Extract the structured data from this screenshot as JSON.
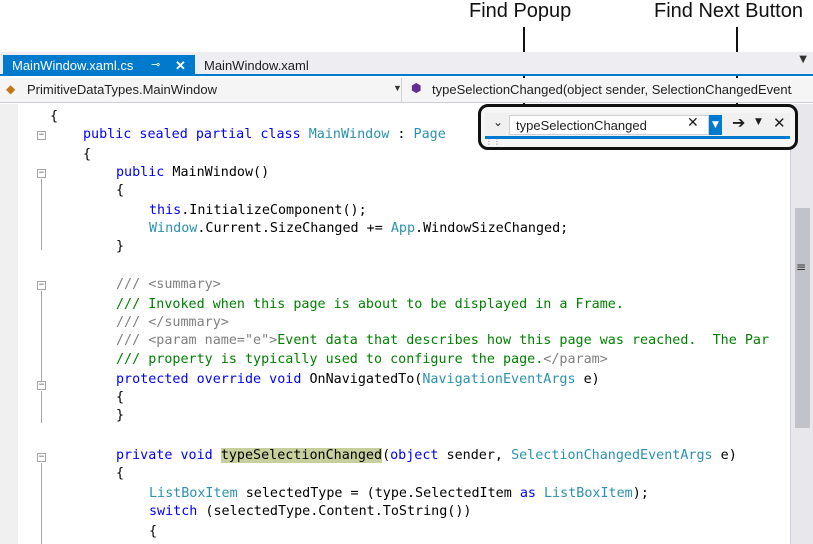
{
  "callouts": {
    "find_popup": "Find Popup",
    "find_next_button": "Find Next Button"
  },
  "tabs": [
    {
      "label": "MainWindow.xaml.cs",
      "active": true
    },
    {
      "label": "MainWindow.xaml",
      "active": false
    }
  ],
  "navbar": {
    "class_selector": "PrimitiveDataTypes.MainWindow",
    "member_selector": "typeSelectionChanged(object sender, SelectionChangedEventArgs e)"
  },
  "find": {
    "value": "typeSelectionChanged"
  },
  "code": {
    "l1": {
      "brace": "{"
    },
    "l2": {
      "kw1": "public sealed partial class",
      "type1": "MainWindow",
      "sep": " : ",
      "type2": "Page"
    },
    "l3": {
      "brace": "{"
    },
    "l4": {
      "kw": "public",
      "rest": " MainWindow()"
    },
    "l5": {
      "brace": "{"
    },
    "l6": {
      "kw": "this",
      "rest": ".InitializeComponent();"
    },
    "l7": {
      "type1": "Window",
      "mid": ".Current.SizeChanged += ",
      "type2": "App",
      "rest": ".WindowSizeChanged;"
    },
    "l8": {
      "brace": "}"
    },
    "l9": {
      "slashes": "///",
      "tag": " <summary>"
    },
    "l10": {
      "text": "/// Invoked when this page is about to be displayed in a Frame."
    },
    "l11": {
      "slashes": "///",
      "tag": " </summary>"
    },
    "l12": {
      "slashes": "///",
      "tag": " <param name=\"e\">",
      "text": "Event data that describes how this page was reached.  The Par"
    },
    "l13": {
      "text": "/// property is typically used to configure the page.",
      "tag": "</param>"
    },
    "l14": {
      "kw": "protected override void",
      "rest1": " OnNavigatedTo(",
      "type": "NavigationEventArgs",
      "rest2": " e)"
    },
    "l15": {
      "brace": "{"
    },
    "l16": {
      "brace": "}"
    },
    "l17": {
      "kw": "private void",
      "sp": " ",
      "hl": "typeSelectionChanged",
      "mid1": "(",
      "kw2": "object",
      "mid2": " sender, ",
      "type": "SelectionChangedEventArgs",
      "rest": " e)"
    },
    "l18": {
      "brace": "{"
    },
    "l19": {
      "type1": "ListBoxItem",
      "mid": " selectedType = (type.SelectedItem ",
      "kw": "as",
      "sp": " ",
      "type2": "ListBoxItem",
      "rest": ");"
    },
    "l20": {
      "kw": "switch",
      "rest": " (selectedType.Content.ToString())"
    },
    "l21": {
      "brace": "{"
    }
  },
  "colors": {
    "accent": "#007acc",
    "keyword": "#0000ff",
    "type": "#2b91af",
    "comment": "#008000",
    "highlight": "#c7cf9c"
  },
  "icons": [
    "pin-icon",
    "close-icon",
    "class-icon",
    "method-icon",
    "chevron-down-icon",
    "arrow-right-icon"
  ]
}
